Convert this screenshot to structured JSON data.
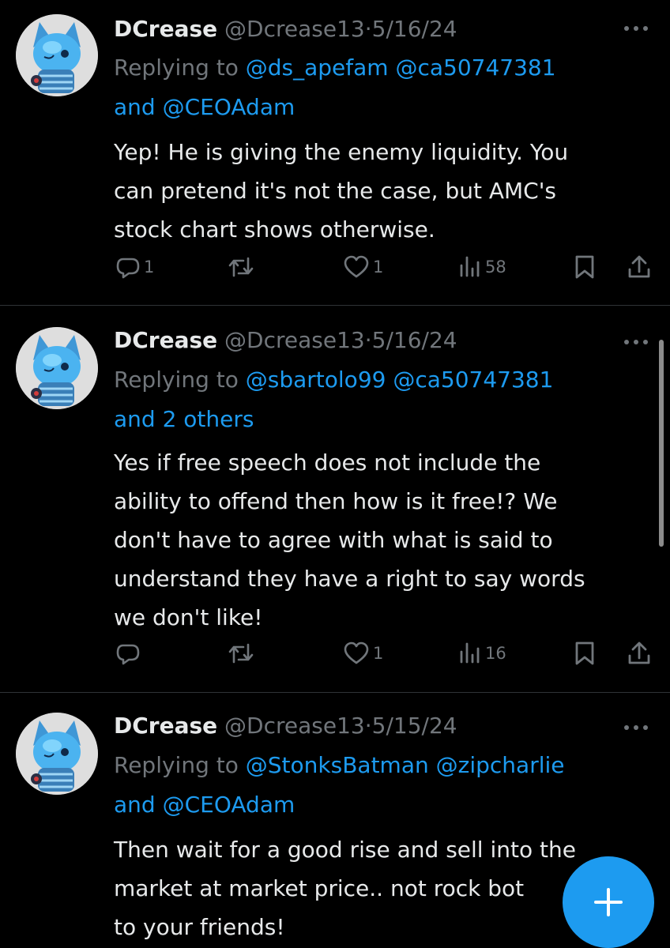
{
  "tweets": [
    {
      "name": "DCrease",
      "handle": "@Dcrease13",
      "sep": "·",
      "date": "5/16/24",
      "replying_label": "Replying to",
      "mention_1": "@ds_apefam",
      "mention_2": "@ca50747381",
      "and_label": "and",
      "mention_3": "@CEOAdam",
      "text_lines": [
        "Yep! He is giving the enemy liquidity. You",
        "can pretend it's not the case, but AMC's",
        "stock chart shows otherwise."
      ],
      "replies": "1",
      "reposts": "",
      "likes": "1",
      "views": "58"
    },
    {
      "name": "DCrease",
      "handle": "@Dcrease13",
      "sep": "·",
      "date": "5/16/24",
      "replying_label": "Replying to",
      "mention_1": "@sbartolo99",
      "mention_2": "@ca50747381",
      "and_label": "",
      "mention_3": "and 2 others",
      "text_lines": [
        "Yes if free speech does not include the",
        "ability to offend then how is it free!? We",
        "don't have to agree with what is said to",
        "understand they have a right to say words",
        "we don't like!"
      ],
      "replies": "",
      "reposts": "",
      "likes": "1",
      "views": "16"
    },
    {
      "name": "DCrease",
      "handle": "@Dcrease13",
      "sep": "·",
      "date": "5/15/24",
      "replying_label": "Replying to",
      "mention_1": "@StonksBatman",
      "mention_2": "@zipcharlie",
      "and_label": "and",
      "mention_3": "@CEOAdam",
      "text_lines": [
        "Then wait for a good rise and sell into the",
        "market at market price.. not rock bot",
        "to your friends!"
      ]
    }
  ],
  "icons": {
    "reply": "reply-icon",
    "repost": "repost-icon",
    "like": "heart-icon",
    "views": "views-icon",
    "bookmark": "bookmark-icon",
    "share": "share-icon",
    "more": "more-icon",
    "compose": "plus-icon"
  },
  "colors": {
    "background": "#000000",
    "text": "#e7e9ea",
    "secondary": "#71767b",
    "accent": "#1d9bf0"
  }
}
